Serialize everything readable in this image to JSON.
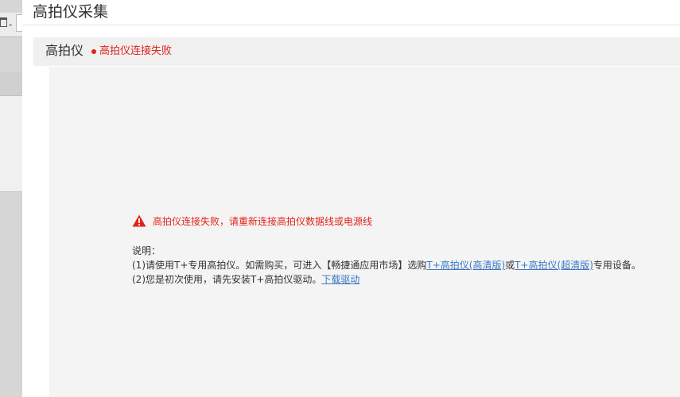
{
  "dialog": {
    "title": "高拍仪采集"
  },
  "panel": {
    "title": "高拍仪",
    "status": "高拍仪连接失败",
    "status_color": "#e2231a"
  },
  "error": {
    "icon": "warning-icon",
    "message": "高拍仪连接失败，请重新连接高拍仪数据线或电源线"
  },
  "notes": {
    "heading": "说明：",
    "line1_prefix": "(1)请使用T+专用高拍仪。如需购买，可进入【畅捷通应用市场】选购",
    "line1_link1": "T+高拍仪(高清版)",
    "line1_or": "或",
    "line1_link2": "T+高拍仪(超清版)",
    "line1_suffix": "专用设备。",
    "line2_prefix": "(2)您是初次使用，请先安装T+高拍仪驱动。",
    "line2_link": "下载驱动"
  },
  "background": {
    "toolbar_separator": "-"
  },
  "colors": {
    "link": "#3a78c3",
    "error": "#e2231a"
  }
}
